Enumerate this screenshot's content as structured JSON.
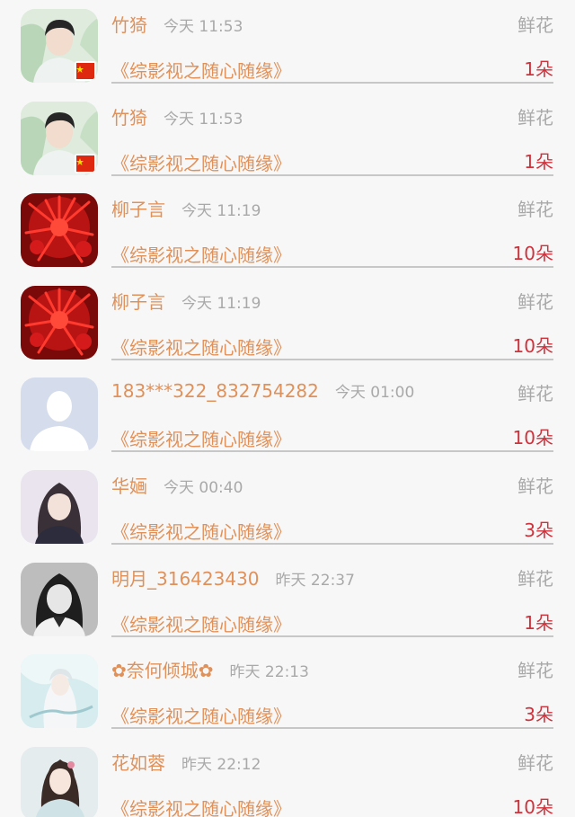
{
  "rows": [
    {
      "name": "竹猗",
      "name_prefix": "",
      "name_suffix": "",
      "time": "今天 11:53",
      "type": "鲜花",
      "book": "《综影视之随心随缘》",
      "count": "1朵",
      "avatar": "avatar-man-flag"
    },
    {
      "name": "竹猗",
      "name_prefix": "",
      "name_suffix": "",
      "time": "今天 11:53",
      "type": "鲜花",
      "book": "《综影视之随心随缘》",
      "count": "1朵",
      "avatar": "avatar-man-flag"
    },
    {
      "name": "柳子言",
      "name_prefix": "",
      "name_suffix": "",
      "time": "今天 11:19",
      "type": "鲜花",
      "book": "《综影视之随心随缘》",
      "count": "10朵",
      "avatar": "avatar-red-flower"
    },
    {
      "name": "柳子言",
      "name_prefix": "",
      "name_suffix": "",
      "time": "今天 11:19",
      "type": "鲜花",
      "book": "《综影视之随心随缘》",
      "count": "10朵",
      "avatar": "avatar-red-flower"
    },
    {
      "name": "183***322_832754282",
      "name_prefix": "",
      "name_suffix": "",
      "time": "今天 01:00",
      "type": "鲜花",
      "book": "《综影视之随心随缘》",
      "count": "10朵",
      "avatar": "avatar-default"
    },
    {
      "name": "华婳",
      "name_prefix": "",
      "name_suffix": "",
      "time": "今天 00:40",
      "type": "鲜花",
      "book": "《综影视之随心随缘》",
      "count": "3朵",
      "avatar": "avatar-girl-dark"
    },
    {
      "name": "明月_316423430",
      "name_prefix": "",
      "name_suffix": "",
      "time": "昨天 22:37",
      "type": "鲜花",
      "book": "《综影视之随心随缘》",
      "count": "1朵",
      "avatar": "avatar-girl-mono"
    },
    {
      "name": "奈何倾城",
      "name_prefix": "✿",
      "name_suffix": "✿",
      "time": "昨天 22:13",
      "type": "鲜花",
      "book": "《综影视之随心随缘》",
      "count": "3朵",
      "avatar": "avatar-ancient-white"
    },
    {
      "name": "花如蓉",
      "name_prefix": "",
      "name_suffix": "",
      "time": "昨天 22:12",
      "type": "鲜花",
      "book": "《综影视之随心随缘》",
      "count": "10朵",
      "avatar": "avatar-ancient-girl"
    }
  ]
}
